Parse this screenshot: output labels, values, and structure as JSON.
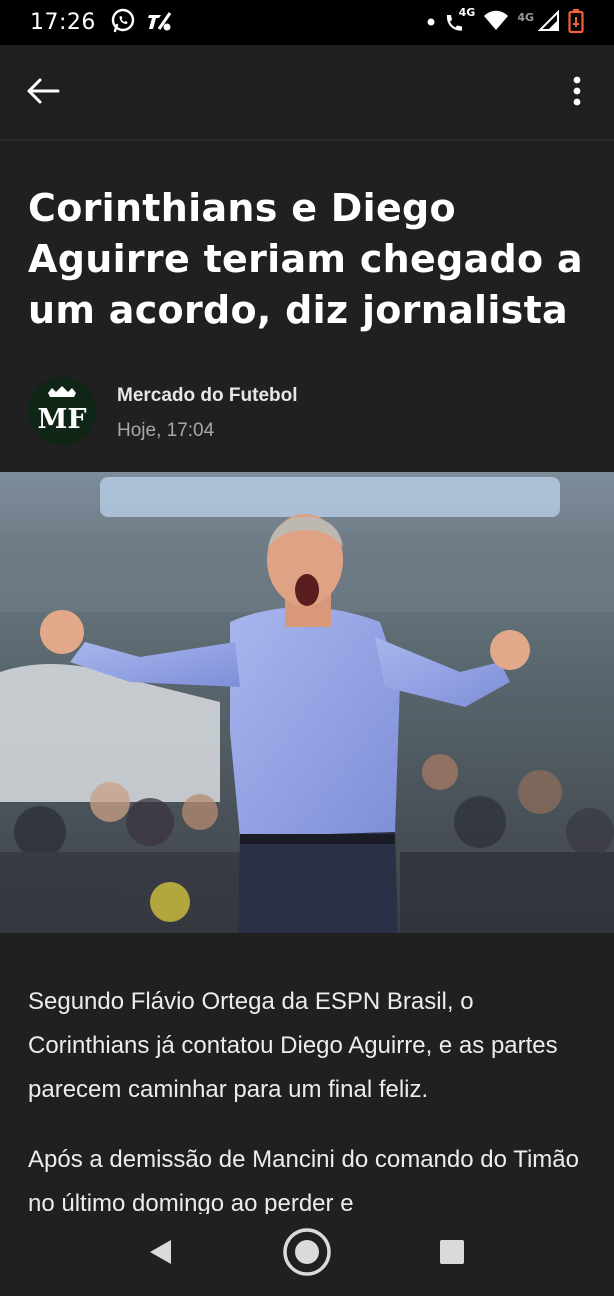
{
  "status_bar": {
    "time": "17:26",
    "network_primary": "4G",
    "network_secondary": "4G",
    "left_icons": [
      "whatsapp-icon",
      "tv-app-icon"
    ],
    "right_icons": [
      "notification-dot-icon",
      "wifi-call-icon",
      "wifi-icon",
      "signal-icon",
      "battery-low-icon"
    ]
  },
  "app_bar": {
    "back_icon": "arrow-left-icon",
    "more_icon": "more-vertical-icon"
  },
  "article": {
    "headline": "Corinthians e Diego Aguirre teriam chegado a um acordo, diz jornalista",
    "source": {
      "name": "Mercado do Futebol",
      "published": "Hoje, 17:04",
      "logo_monogram": "MF"
    },
    "paragraphs": [
      "Segundo Flávio Ortega da ESPN Brasil, o Corinthians já contatou Diego Aguirre, e as partes parecem caminhar para um final feliz.",
      "Após a demissão de Mancini do comando do Timão no último domingo ao perder e"
    ]
  },
  "colors": {
    "background": "#202020",
    "status_bar": "#000000",
    "app_bar": "#1f1f1f",
    "text_primary": "#ffffff",
    "text_secondary": "#a8a8a8",
    "battery_low": "#f0613a",
    "logo_bg": "#0f2616"
  },
  "nav_bar": {
    "icons": [
      "back-triangle-icon",
      "home-circle-icon",
      "recents-square-icon"
    ]
  }
}
